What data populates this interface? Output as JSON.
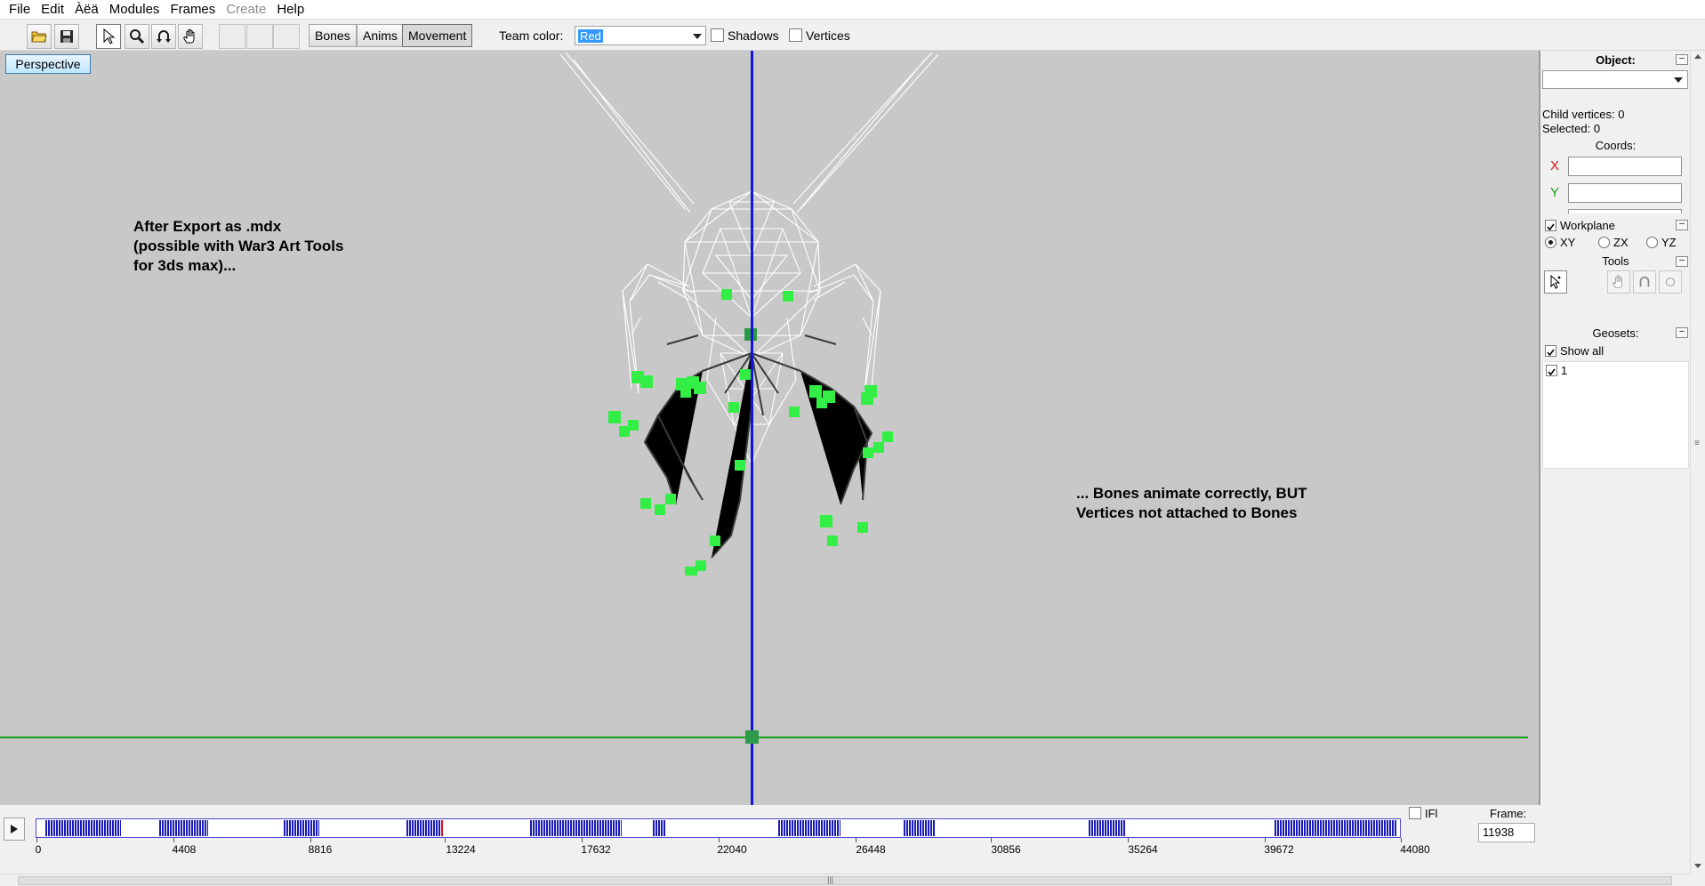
{
  "menu": [
    {
      "label": "File",
      "enabled": true
    },
    {
      "label": "Edit",
      "enabled": true
    },
    {
      "label": "Àëä",
      "enabled": true
    },
    {
      "label": "Modules",
      "enabled": true
    },
    {
      "label": "Frames",
      "enabled": true
    },
    {
      "label": "Create",
      "enabled": false
    },
    {
      "label": "Help",
      "enabled": true
    }
  ],
  "toolbar": {
    "open_icon": "folder-open-icon",
    "save_icon": "floppy-save-icon",
    "select_icon": "arrow-cursor-icon",
    "zoom_icon": "magnifier-icon",
    "rotate_icon": "rotate-arc-icon",
    "pan_icon": "hand-pan-icon",
    "tabs": [
      {
        "label": "Bones",
        "pressed": false
      },
      {
        "label": "Anims",
        "pressed": false
      },
      {
        "label": "Movement",
        "pressed": true
      }
    ],
    "team_color_label": "Team color:",
    "team_color_value": "Red",
    "shadows_label": "Shadows",
    "shadows_checked": false,
    "vertices_label": "Vertices",
    "vertices_checked": false
  },
  "viewport": {
    "view_button": "Perspective",
    "annotation_left": "After Export as .mdx\n(possible with War3 Art Tools\nfor 3ds max)...",
    "annotation_right": "... Bones animate correctly, BUT\nVertices not attached to Bones",
    "background_color": "#c8c8c8",
    "wireframe_color": "#ffffff",
    "bone_color": "#33ee44",
    "axis_vertical_color": "#1414d8",
    "axis_horizontal_color": "#14a014"
  },
  "timeline": {
    "ticks": [
      "0",
      "4408",
      "8816",
      "13224",
      "17632",
      "22040",
      "26448",
      "30856",
      "35264",
      "39672",
      "44080"
    ],
    "ifl_label": "IFl",
    "ifl_checked": false,
    "frame_label": "Frame:",
    "frame_value": "11938",
    "play_icon": "play-triangle-icon"
  },
  "panel": {
    "object_label": "Object:",
    "object_value": "",
    "child_vertices": "Child vertices: 0",
    "selected": "Selected: 0",
    "coords_label": "Coords:",
    "x_label": "X",
    "y_label": "Y",
    "x_color": "#d01818",
    "y_color": "#18a018",
    "workplane_label": "Workplane",
    "workplane_checked": true,
    "planes": [
      {
        "label": "XY",
        "selected": true
      },
      {
        "label": "ZX",
        "selected": false
      },
      {
        "label": "YZ",
        "selected": false
      }
    ],
    "tools_label": "Tools",
    "geosets_label": "Geosets:",
    "show_all_label": "Show all",
    "show_all_checked": true,
    "geosets": [
      {
        "label": "1",
        "checked": true
      }
    ]
  }
}
